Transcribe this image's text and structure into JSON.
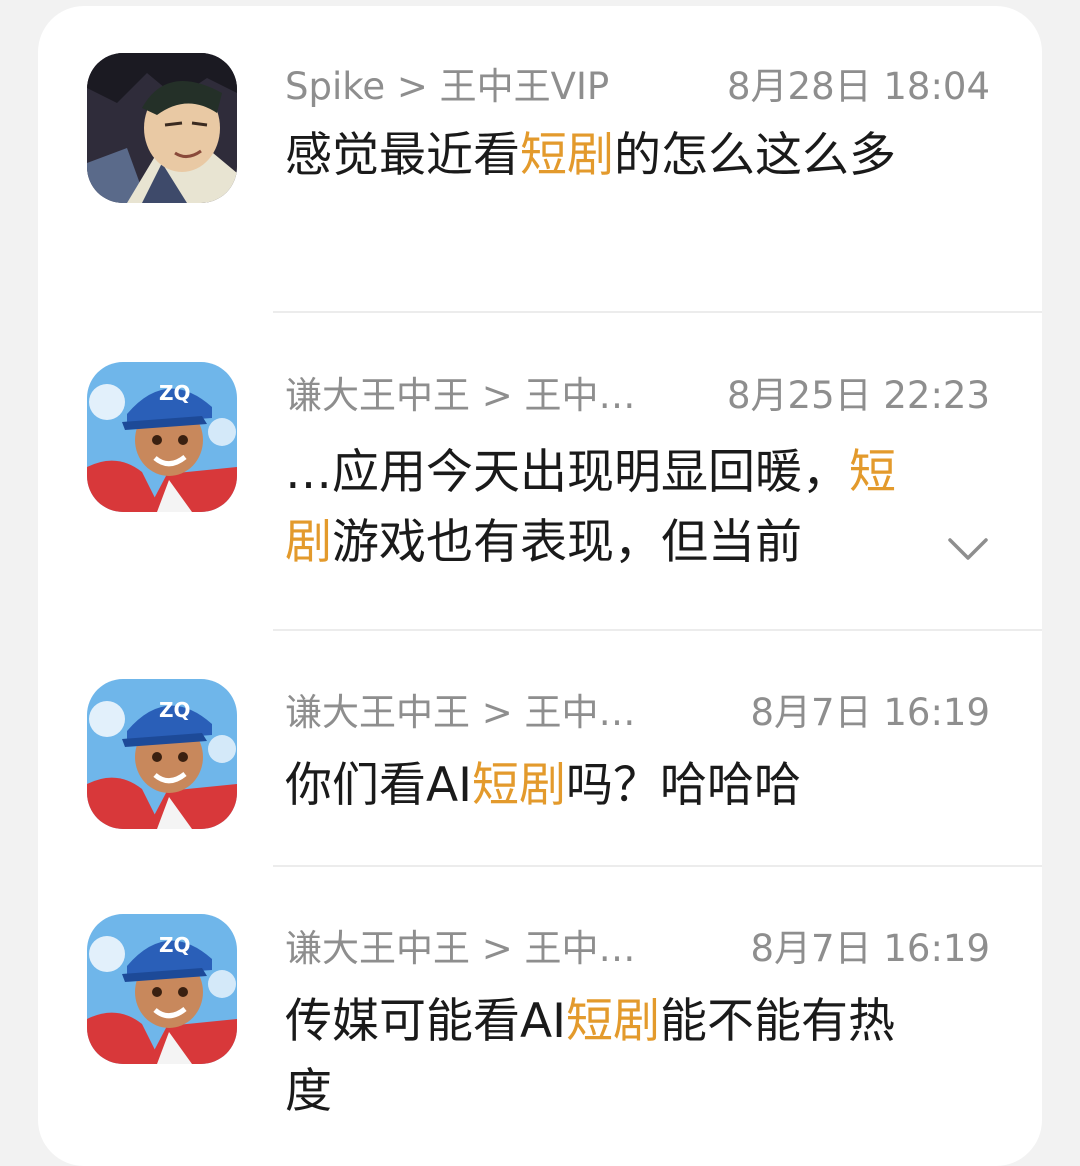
{
  "messages": [
    {
      "avatar": "anime-man-avatar",
      "sender": "Spike > 王中王VIP",
      "time": "8月28日 18:04",
      "parts": [
        "感觉最近看",
        "短剧",
        "的怎么这么多"
      ],
      "expandable": false
    },
    {
      "avatar": "cartoon-boy-cap-avatar",
      "sender": "谦大王中王 > 王中…",
      "time": "8月25日 22:23",
      "parts": [
        "…应用今天出现明显回暖，",
        "短剧",
        "游戏也有表现，但当前"
      ],
      "expandable": true
    },
    {
      "avatar": "cartoon-boy-cap-avatar",
      "sender": "谦大王中王 > 王中…",
      "time": "8月7日 16:19",
      "parts": [
        "你们看AI",
        "短剧",
        "吗？哈哈哈"
      ],
      "expandable": false
    },
    {
      "avatar": "cartoon-boy-cap-avatar",
      "sender": "谦大王中王 > 王中…",
      "time": "8月7日 16:19",
      "parts": [
        "传媒可能看AI",
        "短剧",
        "能不能有热度"
      ],
      "expandable": false
    }
  ],
  "cap_text": "ZQ",
  "colors": {
    "highlight": "#e39a2c",
    "meta": "#8e8e8e",
    "text": "#1a1a1a"
  }
}
